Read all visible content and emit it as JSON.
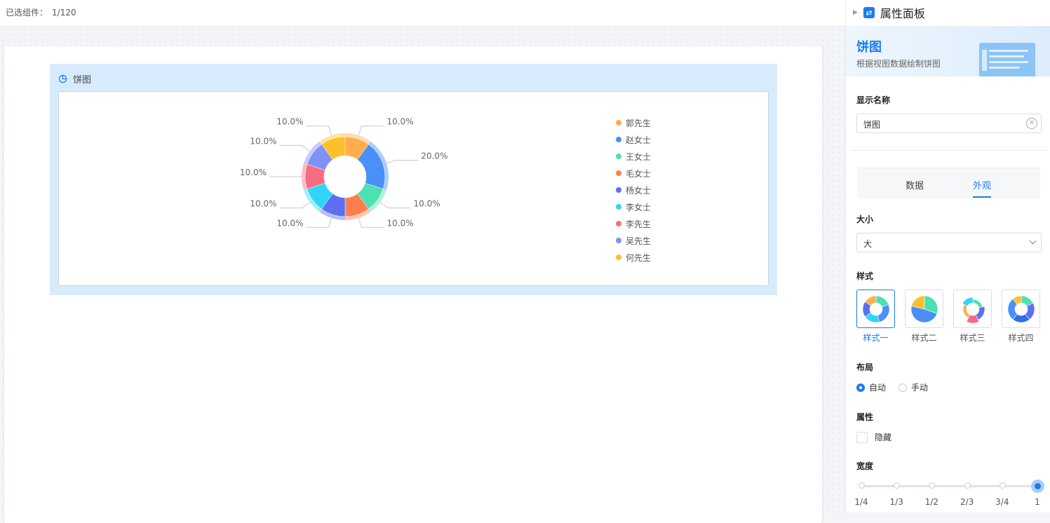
{
  "toolbar": {
    "selected_label": "已选组件：",
    "selected_value": "1/120"
  },
  "widget": {
    "title": "饼图",
    "icon": "pie-chart-icon"
  },
  "chart_data": {
    "type": "pie",
    "donut": true,
    "labels": [
      "郭先生",
      "赵女士",
      "王女士",
      "毛女士",
      "杨女士",
      "李女士",
      "李先生",
      "吴先生",
      "何先生"
    ],
    "values": [
      10,
      20,
      10,
      10,
      10,
      10,
      10,
      10,
      10
    ],
    "slice_labels": [
      "10.0%",
      "20.0%",
      "10.0%",
      "10.0%",
      "10.0%",
      "10.0%",
      "10.0%",
      "10.0%",
      "10.0%"
    ],
    "colors": [
      "#ffad4d",
      "#4a90f8",
      "#4de0b0",
      "#fd7e4d",
      "#5c6ff0",
      "#30d4f6",
      "#f46e83",
      "#7f92f5",
      "#fcc12a"
    ],
    "legend_position": "right"
  },
  "panel": {
    "title": "属性面板",
    "banner_title": "饼图",
    "banner_desc": "根据视图数据绘制饼图",
    "display_name_label": "显示名称",
    "display_name_value": "饼图",
    "tabs": [
      "数据",
      "外观"
    ],
    "active_tab": "外观",
    "size_label": "大小",
    "size_value": "大",
    "style_label": "样式",
    "styles": [
      "样式一",
      "样式二",
      "样式三",
      "样式四"
    ],
    "layout_label": "布局",
    "layout_options": [
      "自动",
      "手动"
    ],
    "attr_label": "属性",
    "hidden_label": "隐藏",
    "width_label": "宽度",
    "width_ticks": [
      "1/4",
      "1/3",
      "1/2",
      "2/3",
      "3/4",
      "1"
    ],
    "width_value": "1",
    "accent": "#1a7cf0"
  }
}
